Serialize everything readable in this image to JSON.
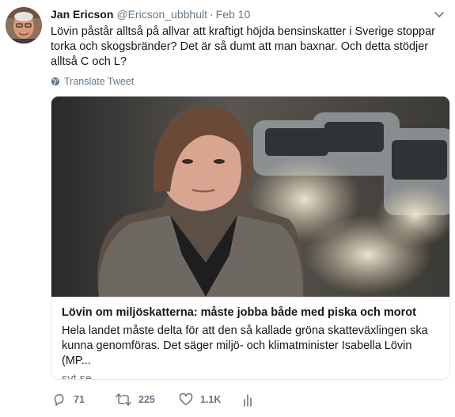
{
  "author": {
    "name": "Jan Ericson",
    "handle": "@Ericson_ubbhult",
    "separator": "·",
    "date": "Feb 10",
    "avatar_icon": "profile-photo"
  },
  "tweet": {
    "text": "Lövin påstår alltså på allvar att kraftigt höjda bensinskatter i Sverige stoppar torka och skogsbränder? Det är så dumt att man baxnar. Och detta stödjer alltså C och L?",
    "translate_label": "Translate Tweet"
  },
  "card": {
    "title": "Lövin om miljöskatterna: måste jobba både med piska och morot",
    "description": "Hela landet måste delta för att den så kallade gröna skatteväxlingen ska kunna genomföras. Det säger miljö- och klimatminister Isabella Lövin (MP...",
    "domain": "svt.se"
  },
  "actions": {
    "replies": "71",
    "retweets": "225",
    "likes": "1.1K"
  },
  "colors": {
    "text": "#14171a",
    "muted": "#657786",
    "border": "#e1e8ed"
  }
}
